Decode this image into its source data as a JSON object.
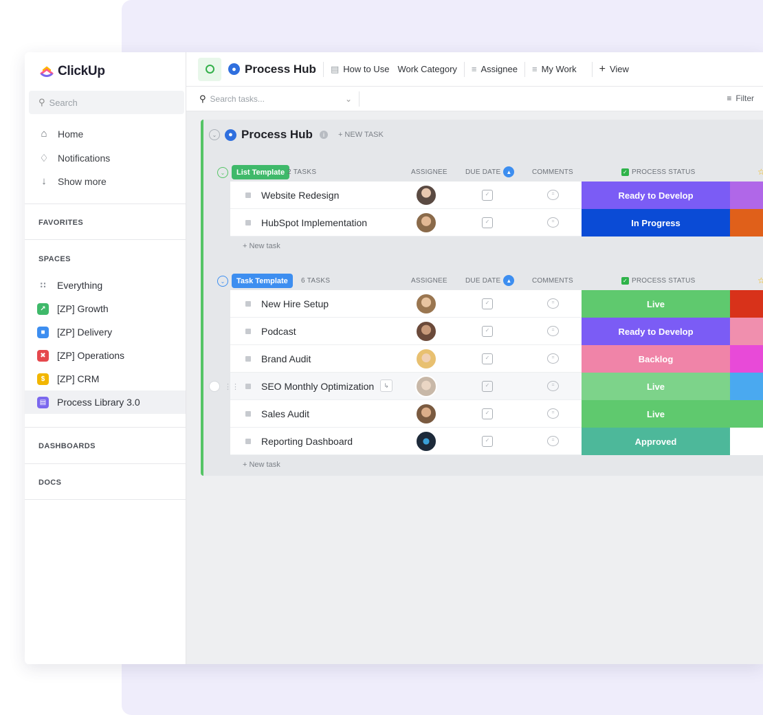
{
  "app": {
    "logo_text": "ClickUp"
  },
  "sidebar": {
    "search_placeholder": "Search",
    "nav": [
      {
        "label": "Home",
        "icon": "home-icon"
      },
      {
        "label": "Notifications",
        "icon": "bell-icon"
      },
      {
        "label": "Show more",
        "icon": "arrow-down-icon"
      }
    ],
    "favorites_label": "FAVORITES",
    "spaces_label": "SPACES",
    "spaces": [
      {
        "label": "Everything",
        "icon": "grid-icon",
        "color": "#ffffff"
      },
      {
        "label": "[ZP] Growth",
        "icon": "chart-icon",
        "color": "#3fb96a"
      },
      {
        "label": "[ZP] Delivery",
        "icon": "truck-icon",
        "color": "#3d8ef0"
      },
      {
        "label": "[ZP] Operations",
        "icon": "tools-icon",
        "color": "#e5484d"
      },
      {
        "label": "[ZP] CRM",
        "icon": "dollar-icon",
        "color": "#f2b600"
      },
      {
        "label": "Process Library 3.0",
        "icon": "book-icon",
        "color": "#7b68ee",
        "active": true
      }
    ],
    "dashboards_label": "DASHBOARDS",
    "docs_label": "DOCS"
  },
  "header": {
    "title": "Process Hub",
    "views": [
      {
        "label": "How to Use",
        "icon": "doc-icon"
      },
      {
        "label": "Work Category",
        "icon": ""
      },
      {
        "label": "Assignee",
        "icon": "list-icon"
      },
      {
        "label": "My Work",
        "icon": "list-icon"
      }
    ],
    "add_view": "View"
  },
  "toolbar": {
    "search_placeholder": "Search tasks...",
    "filter_label": "Filter"
  },
  "board": {
    "title": "Process Hub",
    "new_task_label": "+ NEW TASK",
    "add_task_label": "+ New task",
    "columns": {
      "assignee": "ASSIGNEE",
      "due_date": "DUE DATE",
      "comments": "COMMENTS",
      "process_status": "PROCESS STATUS"
    },
    "groups": [
      {
        "name": "List Template",
        "count": "2 TASKS",
        "color": "#3fb96a",
        "tasks": [
          {
            "name": "Website Redesign",
            "status": "Ready to Develop",
            "status_color": "#7b5cf5",
            "extra_color": "#b067e8",
            "avatar_color": "#5a4a42"
          },
          {
            "name": "HubSpot Implementation",
            "status": "In Progress",
            "status_color": "#0a4bd6",
            "extra_color": "#e0601a",
            "avatar_color": "#8a6a4a"
          }
        ]
      },
      {
        "name": "Task Template",
        "count": "6 TASKS",
        "color": "#3d8ef0",
        "tasks": [
          {
            "name": "New Hire Setup",
            "status": "Live",
            "status_color": "#5fc96e",
            "extra_color": "#d8321a",
            "avatar_color": "#9a7650"
          },
          {
            "name": "Podcast",
            "status": "Ready to Develop",
            "status_color": "#7b5cf5",
            "extra_color": "#f08fae",
            "avatar_color": "#6b4a3a"
          },
          {
            "name": "Brand Audit",
            "status": "Backlog",
            "status_color": "#f084a8",
            "extra_color": "#e84ad8",
            "avatar_color": "#e8c070"
          },
          {
            "name": "SEO Monthly Optimization",
            "status": "Live",
            "status_color": "#7dd38a",
            "extra_color": "#4aa9f0",
            "avatar_color": "#c8b8a8"
          },
          {
            "name": "Sales Audit",
            "status": "Live",
            "status_color": "#5fc96e",
            "extra_color": "#5fc96e",
            "avatar_color": "#7a5a40"
          },
          {
            "name": "Reporting Dashboard",
            "status": "Approved",
            "status_color": "#4db89a",
            "extra_color": "#ffffff",
            "avatar_color": "#1d2a3a"
          }
        ]
      }
    ]
  }
}
